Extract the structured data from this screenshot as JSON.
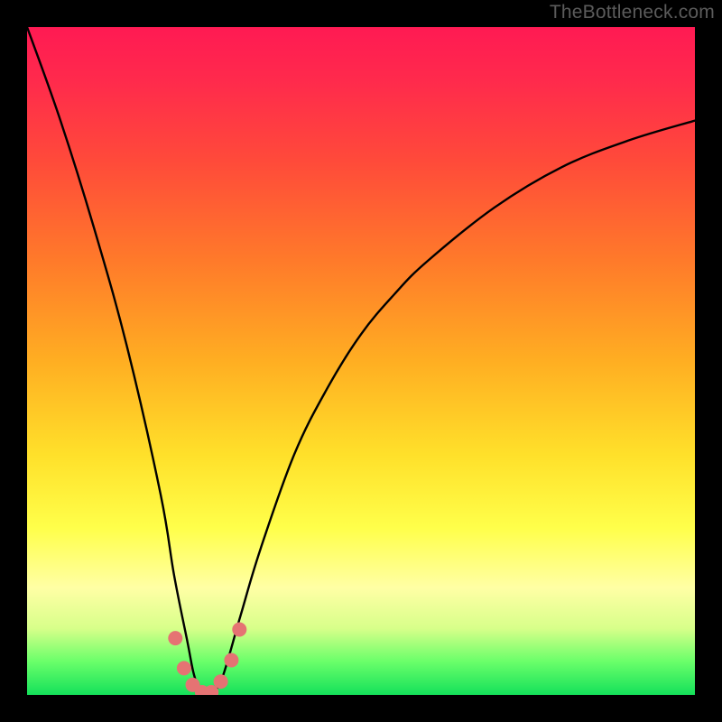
{
  "watermark": "TheBottleneck.com",
  "chart_data": {
    "type": "line",
    "title": "",
    "xlabel": "",
    "ylabel": "",
    "xlim": [
      0,
      100
    ],
    "ylim": [
      0,
      100
    ],
    "series": [
      {
        "name": "bottleneck-curve",
        "x": [
          0,
          5,
          10,
          15,
          20,
          22,
          24,
          25,
          26,
          27,
          28,
          29,
          30,
          32,
          35,
          40,
          45,
          50,
          55,
          60,
          70,
          80,
          90,
          100
        ],
        "values": [
          100,
          86,
          70,
          52,
          30,
          18,
          8,
          3,
          0.5,
          0,
          0.5,
          2,
          5,
          12,
          22,
          36,
          46,
          54,
          60,
          65,
          73,
          79,
          83,
          86
        ]
      }
    ],
    "markers": {
      "name": "highlight-dots",
      "color": "#e57373",
      "points": [
        {
          "x": 22.2,
          "y": 8.5
        },
        {
          "x": 23.5,
          "y": 4.0
        },
        {
          "x": 24.8,
          "y": 1.5
        },
        {
          "x": 26.2,
          "y": 0.4
        },
        {
          "x": 27.6,
          "y": 0.4
        },
        {
          "x": 29.0,
          "y": 2.0
        },
        {
          "x": 30.6,
          "y": 5.2
        },
        {
          "x": 31.8,
          "y": 9.8
        }
      ]
    }
  }
}
